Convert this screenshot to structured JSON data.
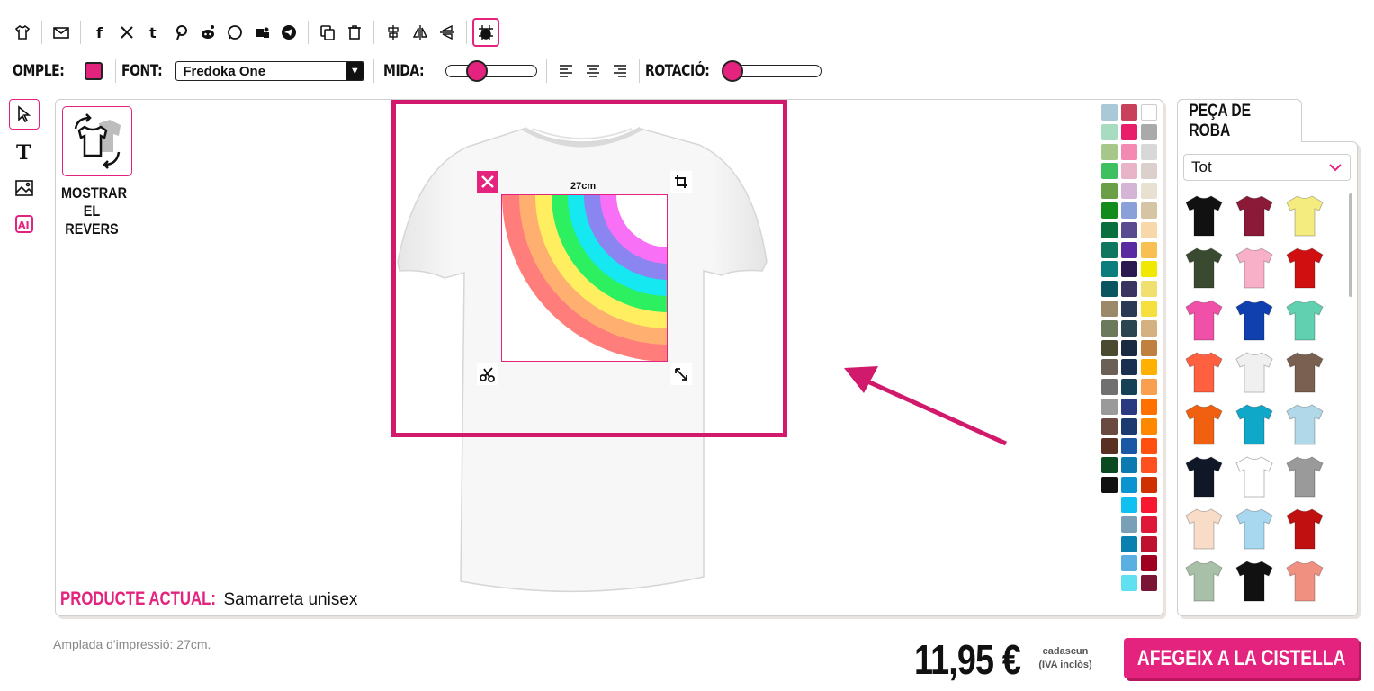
{
  "toolbar": {
    "icons": [
      "tshirt-icon",
      "email-icon",
      "facebook-icon",
      "x-icon",
      "tumblr-icon",
      "pinterest-icon",
      "reddit-icon",
      "whatsapp-icon",
      "teams-icon",
      "telegram-icon",
      "duplicate-icon",
      "delete-icon",
      "align-center-icon",
      "flip-horizontal-icon",
      "flip-vertical-icon",
      "grid-snap-icon"
    ]
  },
  "controls": {
    "fill_label": "OMPLE:",
    "fill_color": "#e3237e",
    "font_label": "FONT:",
    "font_value": "Fredoka One",
    "size_label": "MIDA:",
    "size_fraction": 0.3,
    "rotation_label": "ROTACIÓ:",
    "rotation_fraction": 0.0
  },
  "canvas": {
    "show_back_label_1": "MOSTRAR",
    "show_back_label_2": "EL REVERS",
    "width_label": "27cm",
    "product_label": "PRODUCTE ACTUAL:",
    "product_name": "Samarreta unisex"
  },
  "palette": {
    "columns": [
      [
        "#a9c8d8",
        "#a7dcc0",
        "#a5c88a",
        "#3fc060",
        "#6a9f48",
        "#138a1c",
        "#0a6f3e",
        "#0f7760",
        "#0a7d7c",
        "#0b5560",
        "#9a8a6a",
        "#6a7a5a",
        "#4a4a30",
        "#6a6055",
        "#707070",
        "#9a9a9a",
        "#6a4a40",
        "#5a3025",
        "#0a4a20",
        "#111111"
      ],
      [
        "#c8405a",
        "#e81e6a",
        "#f28ab2",
        "#e8b5c8",
        "#d5b5d5",
        "#8aa0d8",
        "#5a4a90",
        "#5a2aa0",
        "#2a1a50",
        "#3a3560",
        "#2a3a55",
        "#2a4550",
        "#1a2a40",
        "#1a3050",
        "#154055",
        "#2a3a80",
        "#1a3a70",
        "#1a58a5",
        "#0a7ab0",
        "#0a95d0",
        "#10c0f0",
        "#7aa0b8",
        "#0a80b0",
        "#5ab0e0",
        "#60e0f0"
      ],
      [
        "#ffffff",
        "#aaaaaa",
        "#d8d8d8",
        "#dcd0cc",
        "#e8e0d0",
        "#d5c5a5",
        "#f8d8a8",
        "#f8c050",
        "#f0e800",
        "#f0e070",
        "#f5e040",
        "#d5b080",
        "#c08040",
        "#ffb000",
        "#f8a050",
        "#ff7000",
        "#ff8800",
        "#ff5010",
        "#ff5020",
        "#d03000",
        "#f81830",
        "#e01838",
        "#c01030",
        "#a00020",
        "#7a1535"
      ]
    ]
  },
  "products": {
    "tab_label": "PEÇA DE ROBA",
    "filter_value": "Tot",
    "items": [
      {
        "name": "tshirt-black",
        "color": "#111111"
      },
      {
        "name": "tshirt-burgundy",
        "color": "#8a1a38"
      },
      {
        "name": "tshirt-yellow",
        "color": "#f5ec80"
      },
      {
        "name": "tshirt-olive",
        "color": "#3a4a30"
      },
      {
        "name": "tshirt-pink",
        "color": "#f8b0c8"
      },
      {
        "name": "tshirt-red",
        "color": "#d01010"
      },
      {
        "name": "tshirt-fuchsia",
        "color": "#f050a8"
      },
      {
        "name": "tshirt-royal-blue",
        "color": "#1040b0"
      },
      {
        "name": "tshirt-mint",
        "color": "#60d0b0"
      },
      {
        "name": "tshirt-coral",
        "color": "#ff6040"
      },
      {
        "name": "tanktop-white",
        "color": "#f0f0f0"
      },
      {
        "name": "tanktop-brown",
        "color": "#7a6050"
      },
      {
        "name": "hoodie-orange",
        "color": "#f06010"
      },
      {
        "name": "hoodie-turquoise",
        "color": "#10a8c8"
      },
      {
        "name": "tshirt-tie-dye",
        "color": "#b0d8e8"
      },
      {
        "name": "tshirt-navy",
        "color": "#101828"
      },
      {
        "name": "raglan-black-white",
        "color": "#ffffff"
      },
      {
        "name": "hoodie-grey",
        "color": "#9a9a9a"
      },
      {
        "name": "tshirt-peach",
        "color": "#f8dcc8"
      },
      {
        "name": "tshirt-gradient-blue",
        "color": "#a8d8f0"
      },
      {
        "name": "jacket-red",
        "color": "#c01010"
      },
      {
        "name": "longsleeve-sage",
        "color": "#a8c0a8"
      },
      {
        "name": "hoodie-black-orange",
        "color": "#111111"
      },
      {
        "name": "tanktop-salmon",
        "color": "#f09080"
      }
    ]
  },
  "footer": {
    "print_width_note": "Amplada d'impressió: 27cm.",
    "price": "11,95 €",
    "price_note_1": "cadascun",
    "price_note_2": "(IVA inclòs)",
    "cart_button": "AFEGEIX A LA CISTELLA"
  }
}
